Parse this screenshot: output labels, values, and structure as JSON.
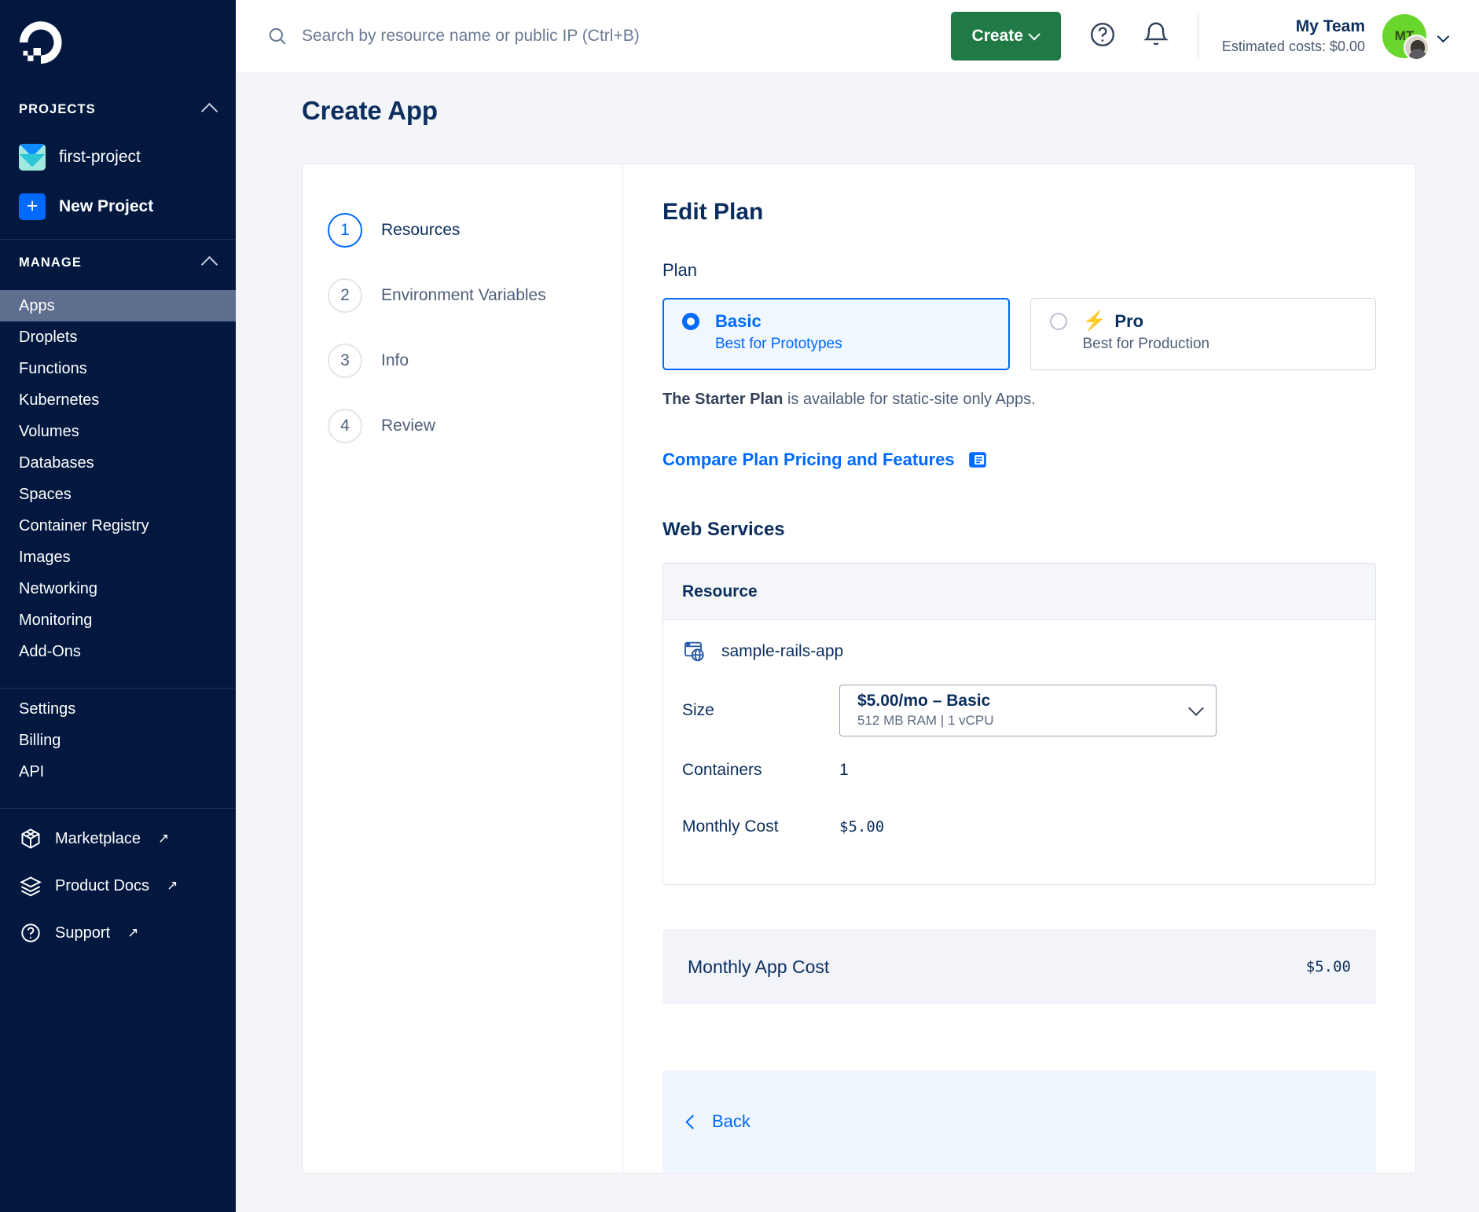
{
  "sidebar": {
    "logo": "digitalocean-logo",
    "projects_section": {
      "title": "PROJECTS",
      "collapse_icon": "chevron-up-icon"
    },
    "projects": [
      {
        "label": "first-project",
        "icon": "project-folder-icon"
      },
      {
        "label": "New Project",
        "icon": "plus-icon"
      }
    ],
    "manage_section": {
      "title": "MANAGE",
      "collapse_icon": "chevron-up-icon"
    },
    "manage_items": [
      "Apps",
      "Droplets",
      "Functions",
      "Kubernetes",
      "Volumes",
      "Databases",
      "Spaces",
      "Container Registry",
      "Images",
      "Networking",
      "Monitoring",
      "Add-Ons"
    ],
    "active_item": "Apps",
    "account_items": [
      "Settings",
      "Billing",
      "API"
    ],
    "external_items": [
      {
        "label": "Marketplace",
        "icon": "cube-icon",
        "arrow": "↗"
      },
      {
        "label": "Product Docs",
        "icon": "layers-icon",
        "arrow": "↗"
      },
      {
        "label": "Support",
        "icon": "question-circle-icon",
        "arrow": "↗"
      }
    ]
  },
  "topbar": {
    "search_placeholder": "Search by resource name or public IP (Ctrl+B)",
    "search_value": "",
    "search_icon": "search-icon",
    "create_label": "Create",
    "help_icon": "question-circle-icon",
    "bell_icon": "bell-icon",
    "team_name": "My Team",
    "team_costs": "Estimated costs: $0.00",
    "avatar_initials": "MT"
  },
  "page": {
    "title": "Create App"
  },
  "steps": [
    {
      "num": "1",
      "label": "Resources",
      "active": true
    },
    {
      "num": "2",
      "label": "Environment Variables",
      "active": false
    },
    {
      "num": "3",
      "label": "Info",
      "active": false
    },
    {
      "num": "4",
      "label": "Review",
      "active": false
    }
  ],
  "pane": {
    "title": "Edit Plan",
    "plan_field_label": "Plan",
    "plans": [
      {
        "name": "Basic",
        "sub": "Best for Prototypes",
        "selected": true,
        "icon": ""
      },
      {
        "name": "Pro",
        "sub": "Best for Production",
        "selected": false,
        "icon": "lightning-bolt-icon"
      }
    ],
    "note_bold": "The Starter Plan",
    "note_rest": " is available for static-site only Apps.",
    "compare_link": "Compare Plan Pricing and Features",
    "compare_icon": "document-icon",
    "web_services_title": "Web Services",
    "table_header": "Resource",
    "resource": {
      "name": "sample-rails-app",
      "icon": "web-service-icon",
      "size_label": "Size",
      "size_value_main": "$5.00/mo – Basic",
      "size_value_sub": "512 MB RAM | 1 vCPU",
      "containers_label": "Containers",
      "containers_value": "1",
      "monthly_cost_label": "Monthly Cost",
      "monthly_cost_value": "$5.00"
    },
    "total_label": "Monthly App Cost",
    "total_value": "$5.00",
    "back_label": "Back"
  },
  "colors": {
    "sidebar_bg": "#03183f",
    "accent_blue": "#0069ff",
    "create_green": "#1f7a46",
    "bolt_orange": "#ff7d2a",
    "avatar_green": "#69d62d"
  }
}
